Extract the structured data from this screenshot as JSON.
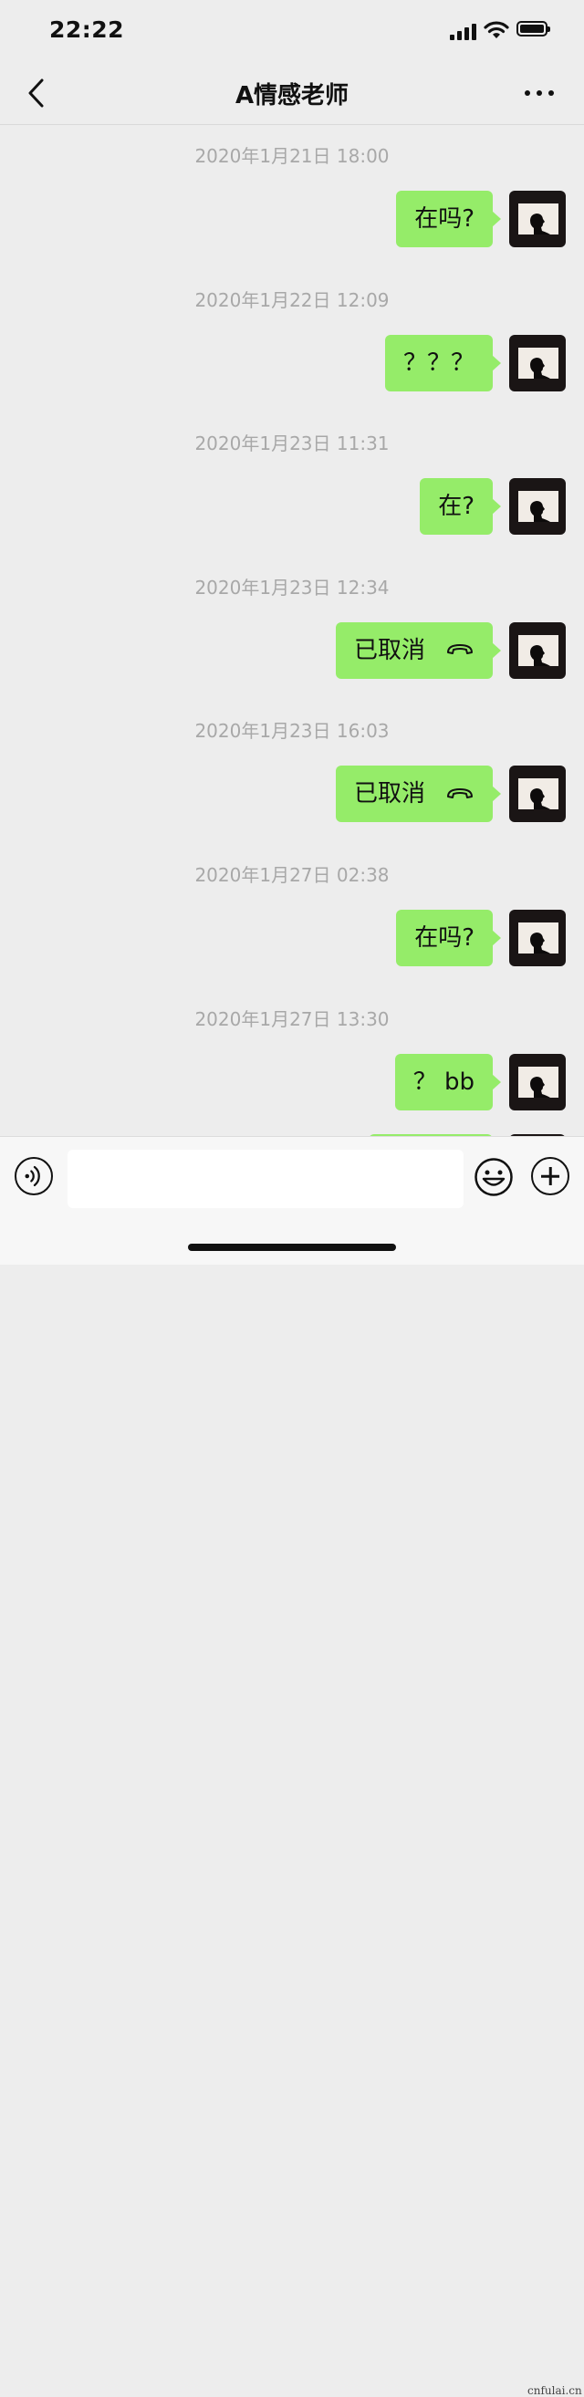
{
  "status_bar": {
    "time": "22:22"
  },
  "header": {
    "title": "A情感老师"
  },
  "messages": [
    {
      "timestamp": "2020年1月21日 18:00",
      "text": "在吗?"
    },
    {
      "timestamp": "2020年1月22日 12:09",
      "text": "？？？"
    },
    {
      "timestamp": "2020年1月23日 11:31",
      "text": "在?"
    },
    {
      "timestamp": "2020年1月23日 12:34",
      "text": "已取消",
      "icon": "hang-up-icon"
    },
    {
      "timestamp": "2020年1月23日 16:03",
      "text": "已取消",
      "icon": "hang-up-icon"
    },
    {
      "timestamp": "2020年1月27日 02:38",
      "text": "在吗?"
    },
    {
      "timestamp": "2020年1月27日 13:30",
      "text": "？ bb"
    }
  ],
  "input_bar": {
    "message_value": "",
    "icons": [
      "voice-icon",
      "emoji-icon",
      "plus-icon"
    ]
  },
  "watermark": "cnfulai.cn",
  "colors": {
    "bubble": "#95ec69",
    "background": "#ededed",
    "timestamp": "#a8a8a8"
  }
}
